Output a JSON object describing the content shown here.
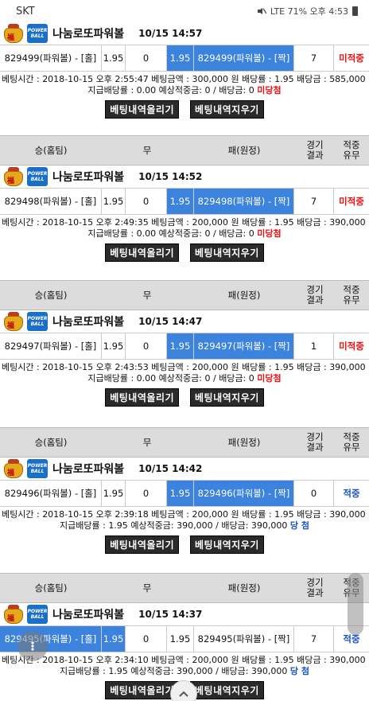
{
  "status_bar": {
    "carrier": "SKT",
    "right_text": "LTE 71% 오후 4:53"
  },
  "header": {
    "col_home": "승(홈팀)",
    "col_draw": "무",
    "col_away": "패(원정)",
    "col_result_1": "경기",
    "col_result_2": "결과",
    "col_hit_1": "적중",
    "col_hit_2": "유무"
  },
  "game_label": "나눔로또파워볼",
  "icons": {
    "fortune_bag": "fortune-bag-icon",
    "powerball": "powerball-icon",
    "fortune_char": "福",
    "pb_top": "POWER",
    "pb_bottom": "BALL"
  },
  "colors": {
    "selected": "#3b83dd",
    "miss": "#e11111",
    "hit": "#1a54c8"
  },
  "buttons": {
    "upload": "베팅내역올리기",
    "delete": "베팅내역지우기"
  },
  "labels": {
    "bet_time": "베팅시간 :",
    "bet_amount": "베팅금액 :",
    "odds": "배당률 :",
    "payout": "배당금 :",
    "paid_odds": "지급배당률 :",
    "expected": "예상적중금:",
    "payout2": "배당금:"
  },
  "bets": [
    {
      "time": "10/15 14:57",
      "home": "829499(파워볼) - [홀]",
      "home_odds": "1.95",
      "draw": "0",
      "away_odds": "1.95",
      "away": "829499(파워볼) - [짝]",
      "result": "7",
      "status": "미적중",
      "status_type": "miss",
      "selected": "away",
      "bet_time": "2018-10-15 오후 2:55:47",
      "amount": "300,000 원",
      "odds": "1.95",
      "payout": "585,000",
      "paid_odds": "0.00",
      "expected": "0",
      "payout2": "0",
      "outcome": "미당첨",
      "outcome_type": "miss"
    },
    {
      "time": "10/15 14:52",
      "home": "829498(파워볼) - [홀]",
      "home_odds": "1.95",
      "draw": "0",
      "away_odds": "1.95",
      "away": "829498(파워볼) - [짝]",
      "result": "7",
      "status": "미적중",
      "status_type": "miss",
      "selected": "away",
      "bet_time": "2018-10-15 오후 2:49:35",
      "amount": "200,000 원",
      "odds": "1.95",
      "payout": "390,000",
      "paid_odds": "0.00",
      "expected": "0",
      "payout2": "0",
      "outcome": "미당첨",
      "outcome_type": "miss"
    },
    {
      "time": "10/15 14:47",
      "home": "829497(파워볼) - [홀]",
      "home_odds": "1.95",
      "draw": "0",
      "away_odds": "1.95",
      "away": "829497(파워볼) - [짝]",
      "result": "1",
      "status": "미적중",
      "status_type": "miss",
      "selected": "away",
      "bet_time": "2018-10-15 오후 2:43:53",
      "amount": "200,000 원",
      "odds": "1.95",
      "payout": "390,000",
      "paid_odds": "0.00",
      "expected": "0",
      "payout2": "0",
      "outcome": "미당첨",
      "outcome_type": "miss"
    },
    {
      "time": "10/15 14:42",
      "home": "829496(파워볼) - [홀]",
      "home_odds": "1.95",
      "draw": "0",
      "away_odds": "1.95",
      "away": "829496(파워볼) - [짝]",
      "result": "0",
      "status": "적중",
      "status_type": "hit",
      "selected": "away",
      "bet_time": "2018-10-15 오후 2:39:18",
      "amount": "200,000 원",
      "odds": "1.95",
      "payout": "390,000",
      "paid_odds": "1.95",
      "expected": "390,000",
      "payout2": "390,000",
      "outcome": "당 첨",
      "outcome_type": "hit"
    },
    {
      "time": "10/15 14:37",
      "home": "829495(파워볼) - [홀]",
      "home_odds": "1.95",
      "draw": "0",
      "away_odds": "1.95",
      "away": "829495(파워볼) - [짝]",
      "result": "7",
      "status": "적중",
      "status_type": "hit",
      "selected": "home",
      "bet_time": "2018-10-15 오후 2:34:10",
      "amount": "200,000 원",
      "odds": "1.95",
      "payout": "390,000",
      "paid_odds": "1.95",
      "expected": "390,000",
      "payout2": "390,000",
      "outcome": "당 첨",
      "outcome_type": "hit"
    }
  ]
}
